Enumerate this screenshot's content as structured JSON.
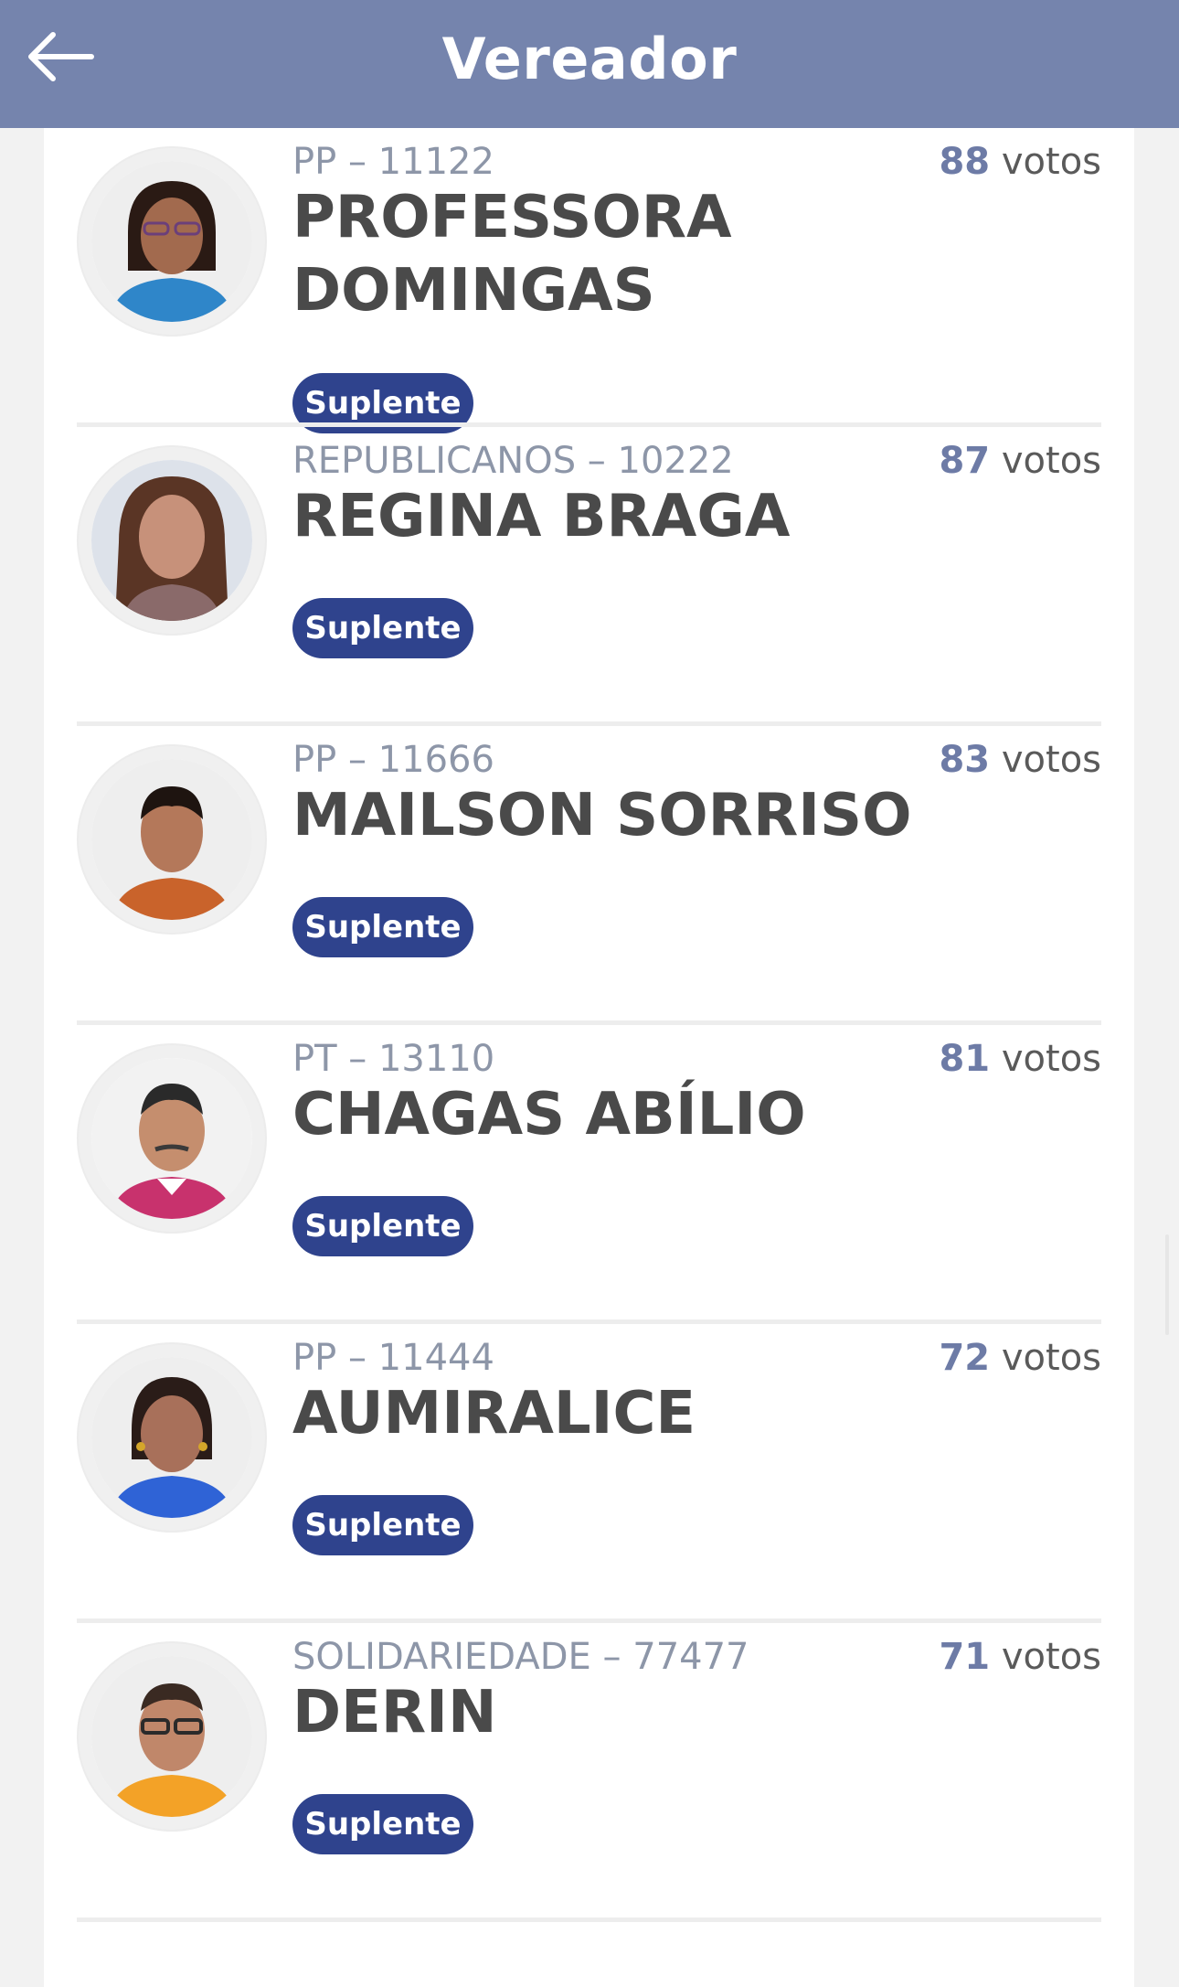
{
  "header": {
    "title": "Vereador",
    "back_icon": "arrow-left-icon"
  },
  "candidates": [
    {
      "party": "PP – 11122",
      "name": "PROFESSORA DOMINGAS",
      "votes_number": "88",
      "votes_unit": "votos",
      "status": "Suplente",
      "photo_colors": {
        "bg": "#eeeeee",
        "skin": "#a26a4e",
        "hair": "#2a1a14",
        "shirt": "#2f86c9"
      }
    },
    {
      "party": "REPUBLICANOS – 10222",
      "name": "REGINA BRAGA",
      "votes_number": "87",
      "votes_unit": "votos",
      "status": "Suplente",
      "photo_colors": {
        "bg": "#dde2ea",
        "skin": "#c7917a",
        "hair": "#5a3525",
        "shirt": "#8a6a6a"
      }
    },
    {
      "party": "PP – 11666",
      "name": "MAILSON SORRISO",
      "votes_number": "83",
      "votes_unit": "votos",
      "status": "Suplente",
      "photo_colors": {
        "bg": "#eeeeee",
        "skin": "#b4785a",
        "hair": "#1e1410",
        "shirt": "#c9632b"
      }
    },
    {
      "party": "PT – 13110",
      "name": "CHAGAS ABÍLIO",
      "votes_number": "81",
      "votes_unit": "votos",
      "status": "Suplente",
      "photo_colors": {
        "bg": "#f2f2f2",
        "skin": "#c58e6e",
        "hair": "#2a2a2a",
        "shirt": "#c8326d"
      }
    },
    {
      "party": "PP – 11444",
      "name": "AUMIRALICE",
      "votes_number": "72",
      "votes_unit": "votos",
      "status": "Suplente",
      "photo_colors": {
        "bg": "#eeeeee",
        "skin": "#a8705a",
        "hair": "#2a1c18",
        "shirt": "#2f63d6"
      }
    },
    {
      "party": "SOLIDARIEDADE – 77477",
      "name": "DERIN",
      "votes_number": "71",
      "votes_unit": "votos",
      "status": "Suplente",
      "photo_colors": {
        "bg": "#eeeeee",
        "skin": "#c0876a",
        "hair": "#3a2a22",
        "shirt": "#f3a227"
      }
    }
  ],
  "colors": {
    "header_bg": "#7584ad",
    "badge_bg": "#2f438d",
    "votes_number": "#6d7ba6",
    "party_text": "#8d96a8",
    "name_text": "#4a4a4a"
  }
}
